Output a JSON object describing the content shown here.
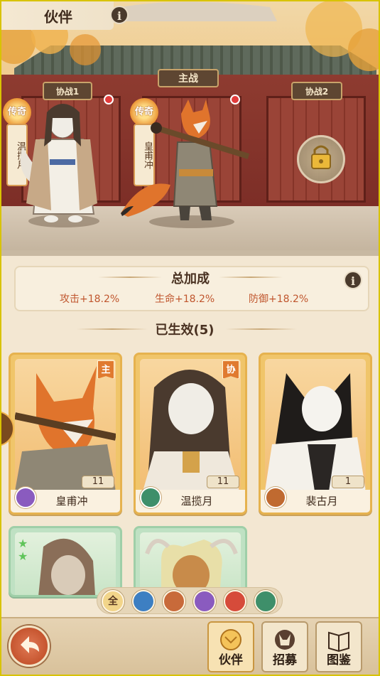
{
  "header": {
    "title": "伙伴"
  },
  "scene": {
    "plaque_main": "主战",
    "plaque_left": "协战1",
    "plaque_right": "协战2",
    "slot_left": {
      "badge": "传奇",
      "name": "温揽月"
    },
    "slot_main": {
      "badge": "传奇",
      "name": "皇甫冲"
    }
  },
  "bonus": {
    "title": "总加成",
    "stats": [
      "攻击+18.2%",
      "生命+18.2%",
      "防御+18.2%"
    ]
  },
  "active": {
    "title": "已生效(5)"
  },
  "cards": [
    {
      "name": "皇甫冲",
      "level": "11",
      "tag": "主",
      "element_color": "#8a5bbf"
    },
    {
      "name": "温揽月",
      "level": "11",
      "tag": "协",
      "element_color": "#3e8f6a"
    },
    {
      "name": "裴古月",
      "level": "1",
      "tag": "",
      "element_color": "#c06a30"
    }
  ],
  "filters": [
    {
      "label": "全",
      "color": "#f2d58a",
      "icon": "all"
    },
    {
      "label": "",
      "color": "#3d7fc2",
      "icon": "water-icon"
    },
    {
      "label": "",
      "color": "#c86a3a",
      "icon": "fist-icon"
    },
    {
      "label": "",
      "color": "#8a5bbf",
      "icon": "spirit-icon"
    },
    {
      "label": "",
      "color": "#d64b3a",
      "icon": "fire-icon"
    },
    {
      "label": "",
      "color": "#3e8f6a",
      "icon": "leaf-icon"
    }
  ],
  "nav": {
    "partner": "伙伴",
    "recruit": "招募",
    "codex": "图鉴"
  }
}
